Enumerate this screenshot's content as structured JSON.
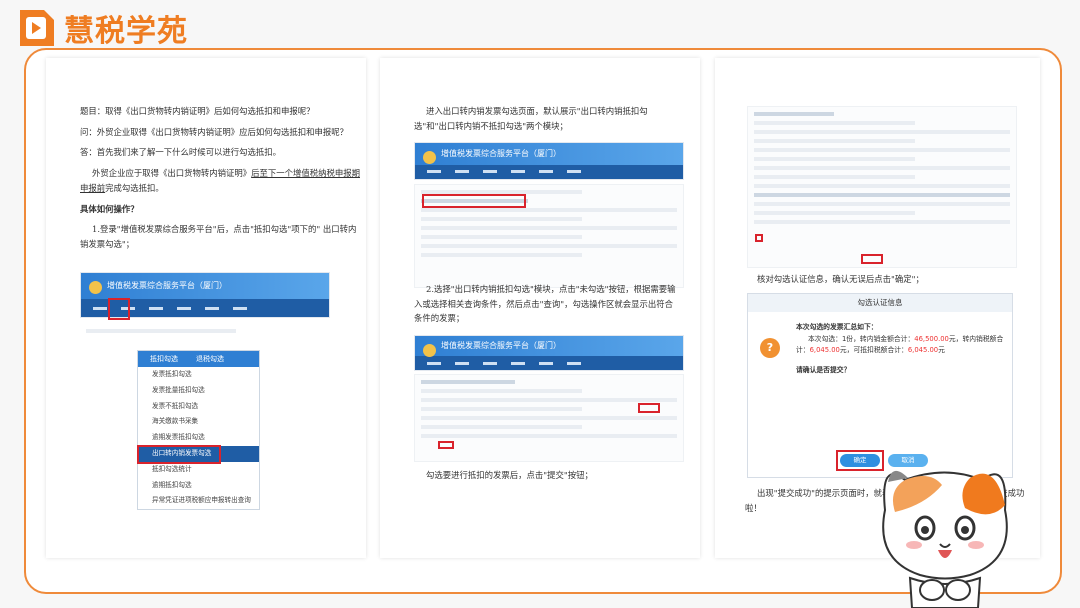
{
  "brand": {
    "name": "慧税学苑",
    "orange": "#ef7d22"
  },
  "panel1": {
    "q_title": "题目：取得《出口货物转内销证明》后如何勾选抵扣和申报呢？",
    "ask": "问：外贸企业取得《出口货物转内销证明》应后如何勾选抵扣和申报呢？",
    "answer": "答：首先我们来了解一下什么时候可以进行勾选抵扣。",
    "para_pre": "外贸企业应于取得《出口货物转内销证明》",
    "para_underline": "后至下一个增值税纳税申报期申报前",
    "para_post": "完成勾选抵扣。",
    "howto": "具体如何操作？",
    "step1": "1.登录\"增值税发票综合服务平台\"后，点击\"抵扣勾选\"项下的\" 出口转内销发票勾选\"；",
    "portal_title": "增值税发票综合服务平台（厦门）",
    "menu": {
      "tabs": [
        "抵扣勾选",
        "退税勾选"
      ],
      "items": [
        "发票抵扣勾选",
        "发票批量抵扣勾选",
        "发票不抵扣勾选",
        "海关缴款书采集",
        "逾期发票抵扣勾选",
        "出口转内销发票勾选",
        "抵扣勾选统计",
        "逾期抵扣勾选",
        "异常凭证进项税额应申报转出查询"
      ],
      "selected_index": 5
    }
  },
  "panel2": {
    "intro": "进入出口转内销发票勾选页面，默认展示\"出口转内销抵扣勾选\"和\"出口转内销不抵扣勾选\"两个模块；",
    "step2": "2.选择\"出口转内销抵扣勾选\"模块，点击\"未勾选\"按钮，根据需要输入或选择相关查询条件，然后点击\"查询\"，勾选操作区就会显示出符合条件的发票；",
    "step3": "勾选要进行抵扣的发票后，点击\"提交\"按钮；",
    "portal_title": "增值税发票综合服务平台（厦门）"
  },
  "panel3": {
    "confirm_text": "核对勾选认证信息，确认无误后点击\"确定\"；",
    "dialog": {
      "title": "勾选认证信息",
      "summary_title": "本次勾选的发票汇总如下：",
      "line1_pre": "本次勾选：1份，转内销金额合计：",
      "amount": "46,500.00",
      "line1_mid": "元，转内销税额合计：",
      "tax": "6,045.00",
      "line2_mid": "元，可抵扣税额合计：",
      "deductible": "6,045.00",
      "yuan": "元",
      "question": "请确认是否提交？",
      "ok": "确定",
      "cancel": "取消"
    },
    "success_text": "出现\"提交成功\"的提示页面时，就表示出口转内销勾选认证信息提交成功啦！"
  }
}
